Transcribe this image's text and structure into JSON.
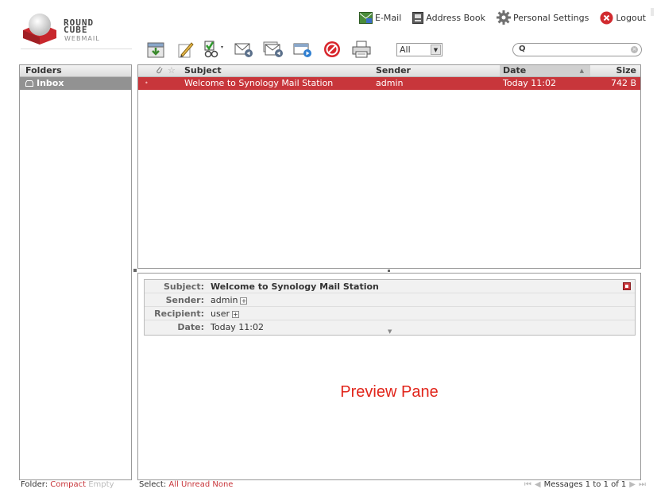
{
  "logo": {
    "line1": "ROUND",
    "line2": "CUBE",
    "line3": "WEBMAIL"
  },
  "taskbar": [
    {
      "label": "E-Mail",
      "icon": "mail-icon"
    },
    {
      "label": "Address Book",
      "icon": "address-book-icon"
    },
    {
      "label": "Personal Settings",
      "icon": "gear-icon"
    },
    {
      "label": "Logout",
      "icon": "logout-icon"
    }
  ],
  "toolbar": {
    "buttons": [
      "check-mail",
      "compose",
      "mark",
      "reply",
      "reply-all",
      "forward",
      "delete",
      "print"
    ],
    "filter_value": "All"
  },
  "folders": {
    "header": "Folders",
    "items": [
      {
        "name": "Inbox",
        "selected": true
      }
    ]
  },
  "message_list": {
    "columns": {
      "subject": "Subject",
      "sender": "Sender",
      "date": "Date",
      "size": "Size"
    },
    "sort_indicator": "▲",
    "rows": [
      {
        "subject": "Welcome to Synology Mail Station",
        "sender": "admin",
        "date": "Today 11:02",
        "size": "742 B",
        "unread_marker": "•",
        "selected": true
      }
    ]
  },
  "preview": {
    "subject_label": "Subject:",
    "subject": "Welcome to Synology Mail Station",
    "sender_label": "Sender:",
    "sender": "admin",
    "recipient_label": "Recipient:",
    "recipient": "user",
    "date_label": "Date:",
    "date": "Today 11:02",
    "pane_label": "Preview Pane"
  },
  "footer": {
    "folder_label": "Folder:",
    "compact": "Compact",
    "empty": "Empty",
    "select_label": "Select:",
    "select_all": "All",
    "select_unread": "Unread",
    "select_none": "None",
    "count": "Messages 1 to 1 of 1"
  },
  "colors": {
    "accent": "#c8363b",
    "preview_label": "#e1251b"
  }
}
